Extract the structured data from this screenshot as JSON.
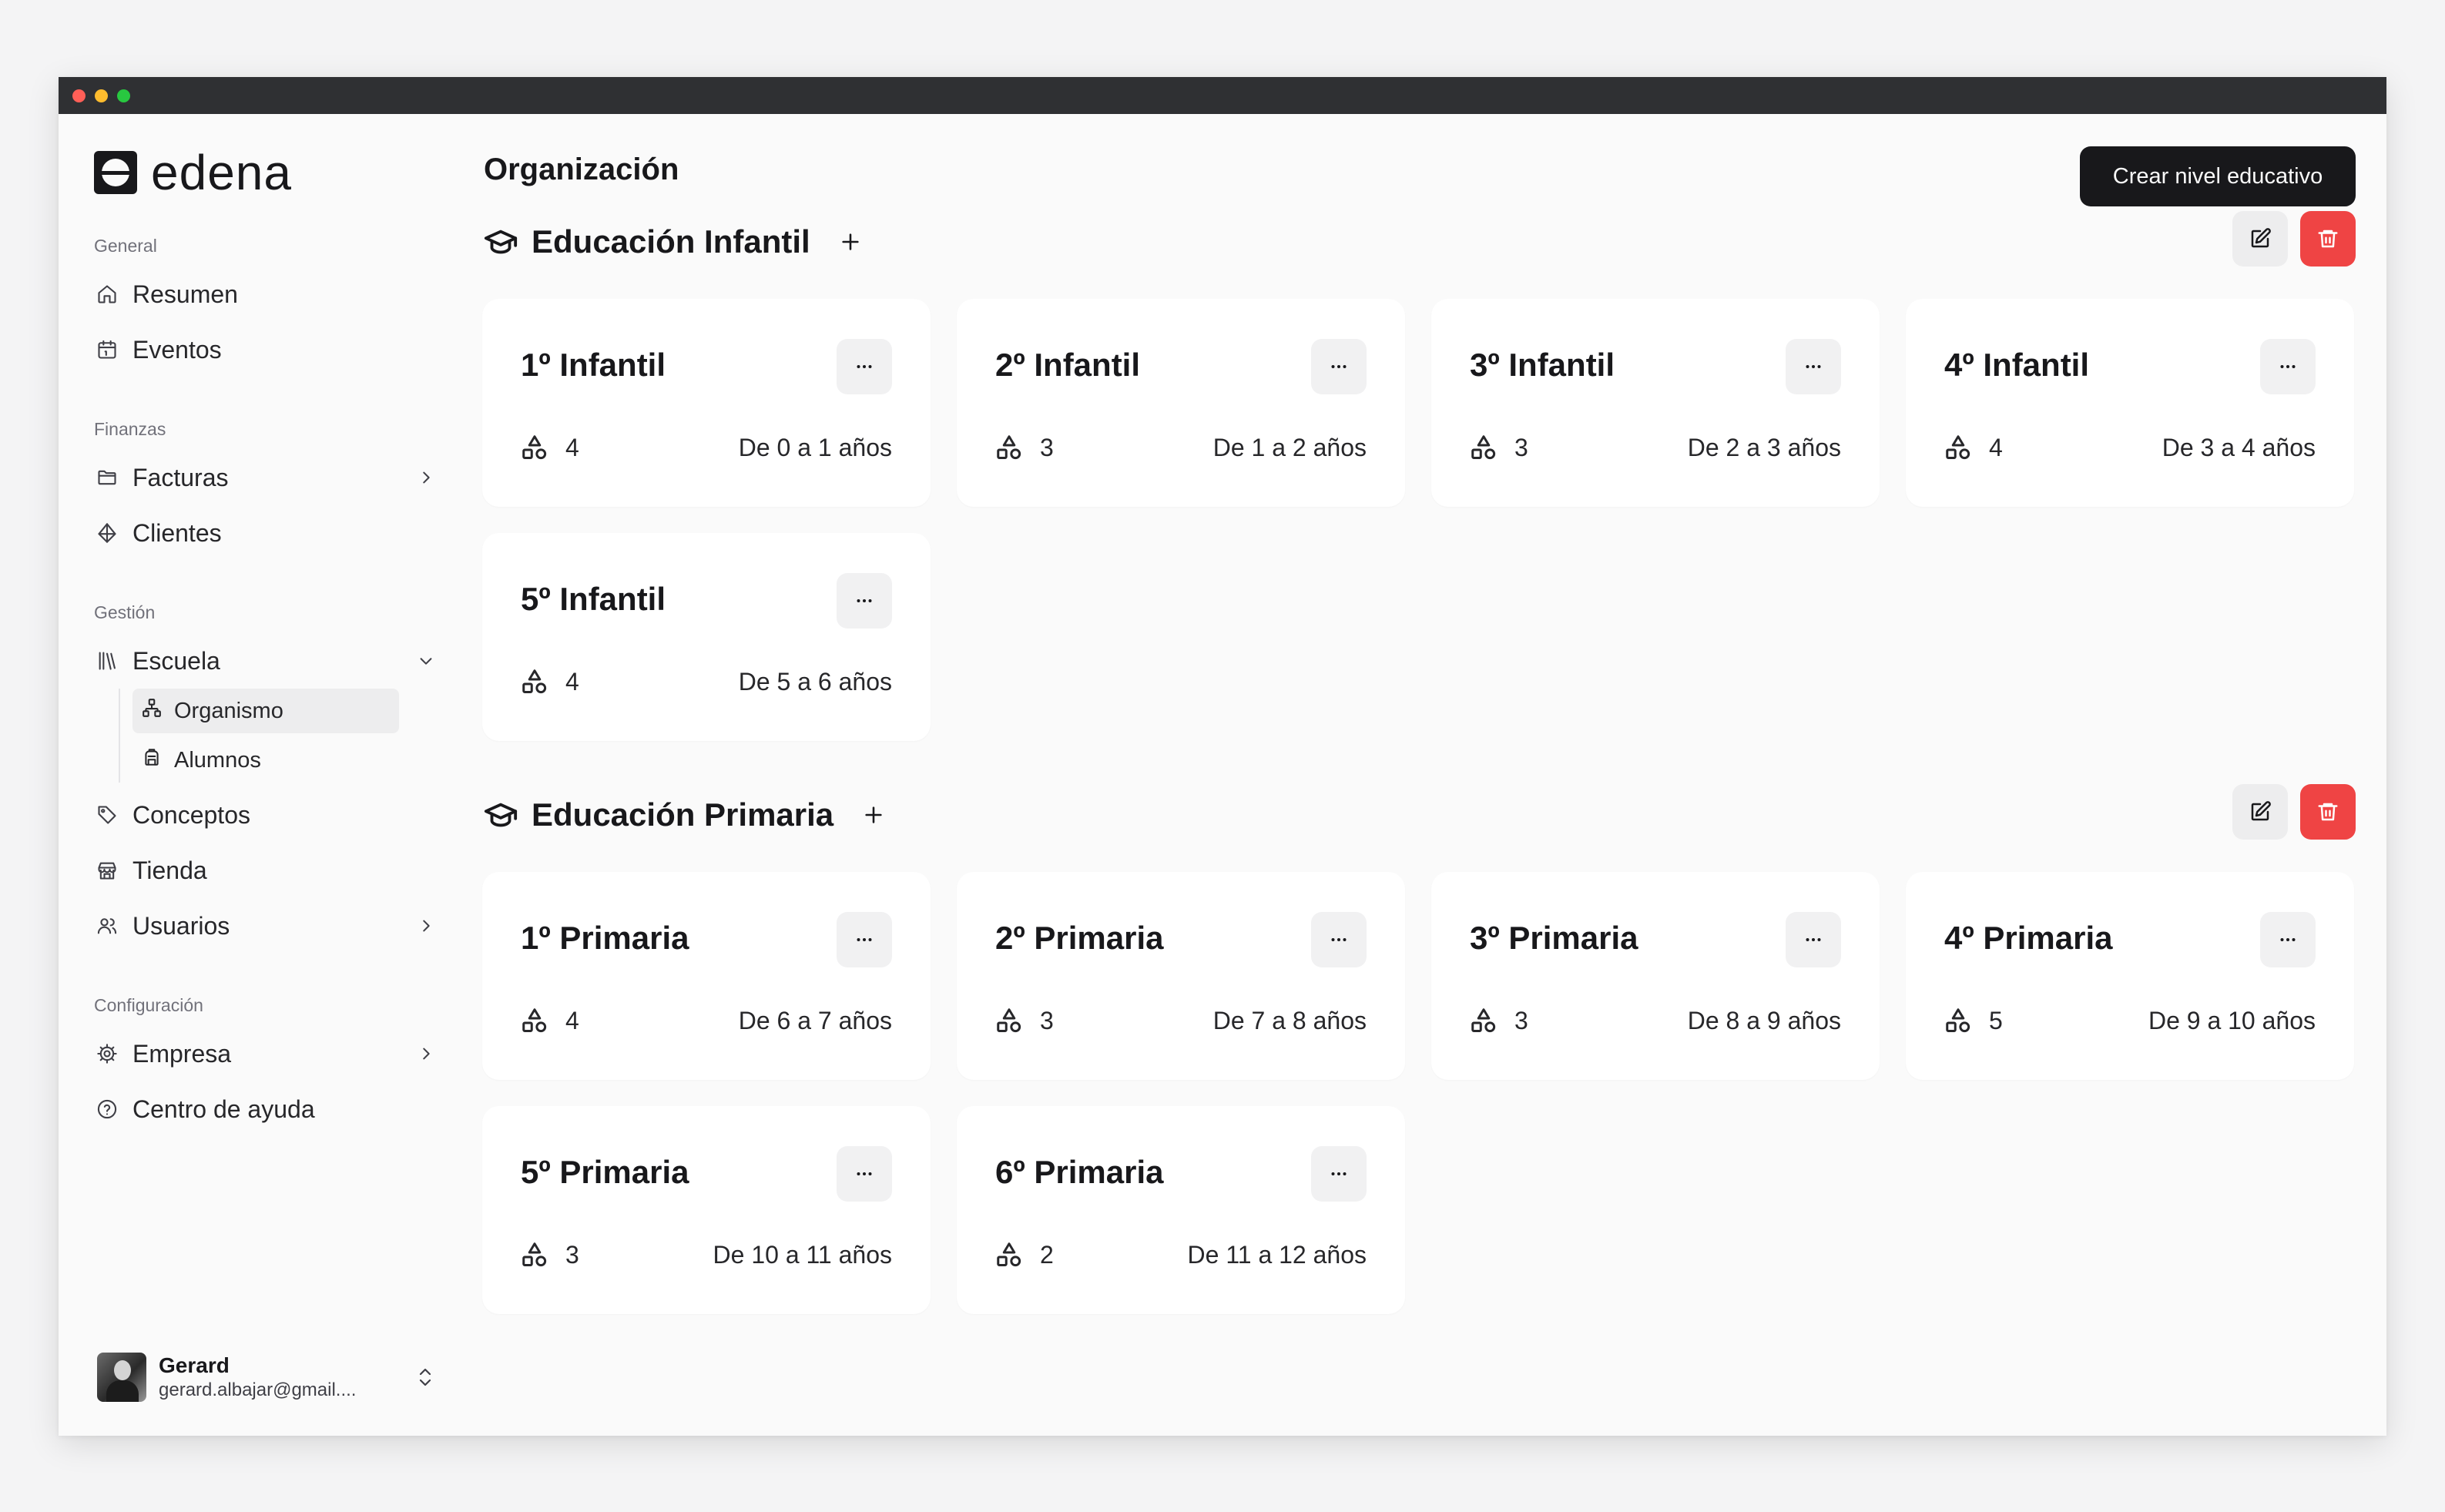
{
  "window": {
    "controls": [
      "close",
      "minimize",
      "maximize"
    ]
  },
  "brand": {
    "name": "edena",
    "logo_icon": "edena-logo-icon"
  },
  "sidebar": {
    "groups": [
      {
        "label": "General",
        "items": [
          {
            "label": "Resumen",
            "icon": "home-icon"
          },
          {
            "label": "Eventos",
            "icon": "calendar-icon"
          }
        ]
      },
      {
        "label": "Finanzas",
        "items": [
          {
            "label": "Facturas",
            "icon": "folder-icon",
            "has_children": true
          },
          {
            "label": "Clientes",
            "icon": "gem-icon"
          }
        ]
      },
      {
        "label": "Gestión",
        "items": [
          {
            "label": "Escuela",
            "icon": "library-icon",
            "expanded": true,
            "children": [
              {
                "label": "Organismo",
                "icon": "network-icon",
                "active": true
              },
              {
                "label": "Alumnos",
                "icon": "backpack-icon"
              }
            ]
          },
          {
            "label": "Conceptos",
            "icon": "tag-icon"
          },
          {
            "label": "Tienda",
            "icon": "store-icon"
          },
          {
            "label": "Usuarios",
            "icon": "users-icon",
            "has_children": true
          }
        ]
      },
      {
        "label": "Configuración",
        "items": [
          {
            "label": "Empresa",
            "icon": "cog-icon",
            "has_children": true
          },
          {
            "label": "Centro de ayuda",
            "icon": "help-circle-icon"
          }
        ]
      }
    ]
  },
  "user": {
    "name": "Gerard",
    "email": "gerard.albajar@gmail...."
  },
  "main": {
    "title": "Organización",
    "create_button": "Crear nivel educativo",
    "sections": [
      {
        "title": "Educación Infantil",
        "cards": [
          {
            "title": "1º Infantil",
            "count": "4",
            "ages": "De 0 a 1 años"
          },
          {
            "title": "2º Infantil",
            "count": "3",
            "ages": "De 1 a 2 años"
          },
          {
            "title": "3º Infantil",
            "count": "3",
            "ages": "De 2 a 3 años"
          },
          {
            "title": "4º Infantil",
            "count": "4",
            "ages": "De 3 a 4 años"
          },
          {
            "title": "5º Infantil",
            "count": "4",
            "ages": "De 5 a 6 años"
          }
        ]
      },
      {
        "title": "Educación Primaria",
        "cards": [
          {
            "title": "1º Primaria",
            "count": "4",
            "ages": "De 6 a 7 años"
          },
          {
            "title": "2º Primaria",
            "count": "3",
            "ages": "De 7 a 8 años"
          },
          {
            "title": "3º Primaria",
            "count": "3",
            "ages": "De 8 a 9 años"
          },
          {
            "title": "4º Primaria",
            "count": "5",
            "ages": "De 9 a 10 años"
          },
          {
            "title": "5º Primaria",
            "count": "3",
            "ages": "De 10 a 11 años"
          },
          {
            "title": "6º Primaria",
            "count": "2",
            "ages": "De 11 a 12 años"
          }
        ]
      }
    ]
  },
  "colors": {
    "accent": "#18181b",
    "danger": "#ef4444",
    "background": "#fafafa",
    "card": "#ffffff"
  }
}
